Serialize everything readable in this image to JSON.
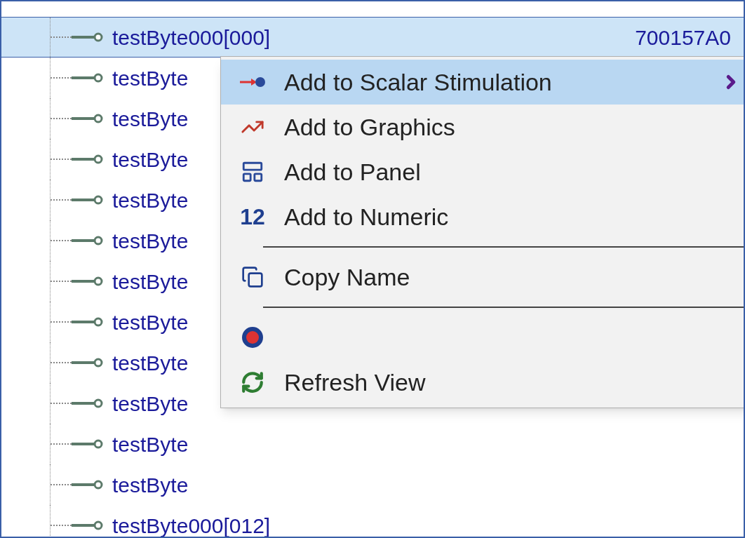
{
  "tree": {
    "rows": [
      {
        "name": "testByte000[000]",
        "value": "700157A0",
        "selected": true
      },
      {
        "name": "testByte",
        "selected": false
      },
      {
        "name": "testByte",
        "selected": false
      },
      {
        "name": "testByte",
        "selected": false
      },
      {
        "name": "testByte",
        "selected": false
      },
      {
        "name": "testByte",
        "selected": false
      },
      {
        "name": "testByte",
        "selected": false
      },
      {
        "name": "testByte",
        "selected": false
      },
      {
        "name": "testByte",
        "selected": false
      },
      {
        "name": "testByte",
        "selected": false
      },
      {
        "name": "testByte",
        "selected": false
      },
      {
        "name": "testByte",
        "selected": false
      },
      {
        "name": "testByte000[012]",
        "selected": false
      }
    ]
  },
  "context_menu": {
    "items": [
      {
        "kind": "item",
        "label": "Add to Scalar Stimulation",
        "submenu": true,
        "selected": true
      },
      {
        "kind": "item",
        "label": "Add to Graphics",
        "selected": false
      },
      {
        "kind": "item",
        "label": "Add to Panel",
        "selected": false
      },
      {
        "kind": "item",
        "icon_text": "12",
        "label": "Add to Numeric",
        "selected": false
      },
      {
        "kind": "separator"
      },
      {
        "kind": "item",
        "label": "Copy Name",
        "selected": false
      },
      {
        "kind": "separator"
      },
      {
        "kind": "item",
        "selected": false
      },
      {
        "kind": "item",
        "label": "Refresh View",
        "selected": false
      }
    ]
  }
}
